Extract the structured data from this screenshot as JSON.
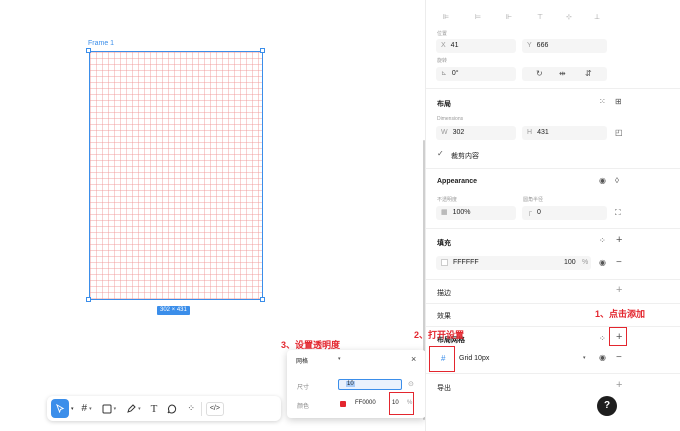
{
  "canvas": {
    "frame_label": "Frame 1",
    "size_badge": "302 × 431"
  },
  "toolbar": {
    "tools": [
      "move-tool",
      "frame-tool",
      "rectangle-tool",
      "pen-tool",
      "text-tool",
      "comment-tool",
      "plugins-tool",
      "dev-mode-tool"
    ],
    "code_label": "</>"
  },
  "popup": {
    "type_label": "网格",
    "size_label": "尺寸",
    "size_value": "10",
    "color_label": "颜色",
    "color_hex": "FF0000",
    "opacity_value": "10",
    "opacity_unit": "%",
    "close": "×"
  },
  "panel": {
    "position_label": "位置",
    "x_prefix": "X",
    "x_value": "41",
    "y_prefix": "Y",
    "y_value": "666",
    "rotation_label": "旋转",
    "rotation_value": "0°",
    "layout_title": "布局",
    "dimensions_label": "Dimensions",
    "w_prefix": "W",
    "w_value": "302",
    "h_prefix": "H",
    "h_value": "431",
    "clip_label": "裁剪内容",
    "appearance_title": "Appearance",
    "opacity_label": "不透明度",
    "opacity_value": "100%",
    "radius_label": "圆角半径",
    "radius_value": "0",
    "fill_title": "填充",
    "fill_hex": "FFFFFF",
    "fill_opacity": "100",
    "fill_pct": "%",
    "stroke_title": "描边",
    "effects_title": "效果",
    "layout_grid_title": "布局网格",
    "grid_name": "Grid 10px",
    "export_title": "导出",
    "help": "?"
  },
  "annotations": {
    "step1": "1、点击添加",
    "step2": "2、打开设置",
    "step3": "3、设置透明度"
  },
  "colors": {
    "accent": "#3b8eea",
    "annotation": "#e3262e",
    "grid_color": "#FF0000"
  }
}
